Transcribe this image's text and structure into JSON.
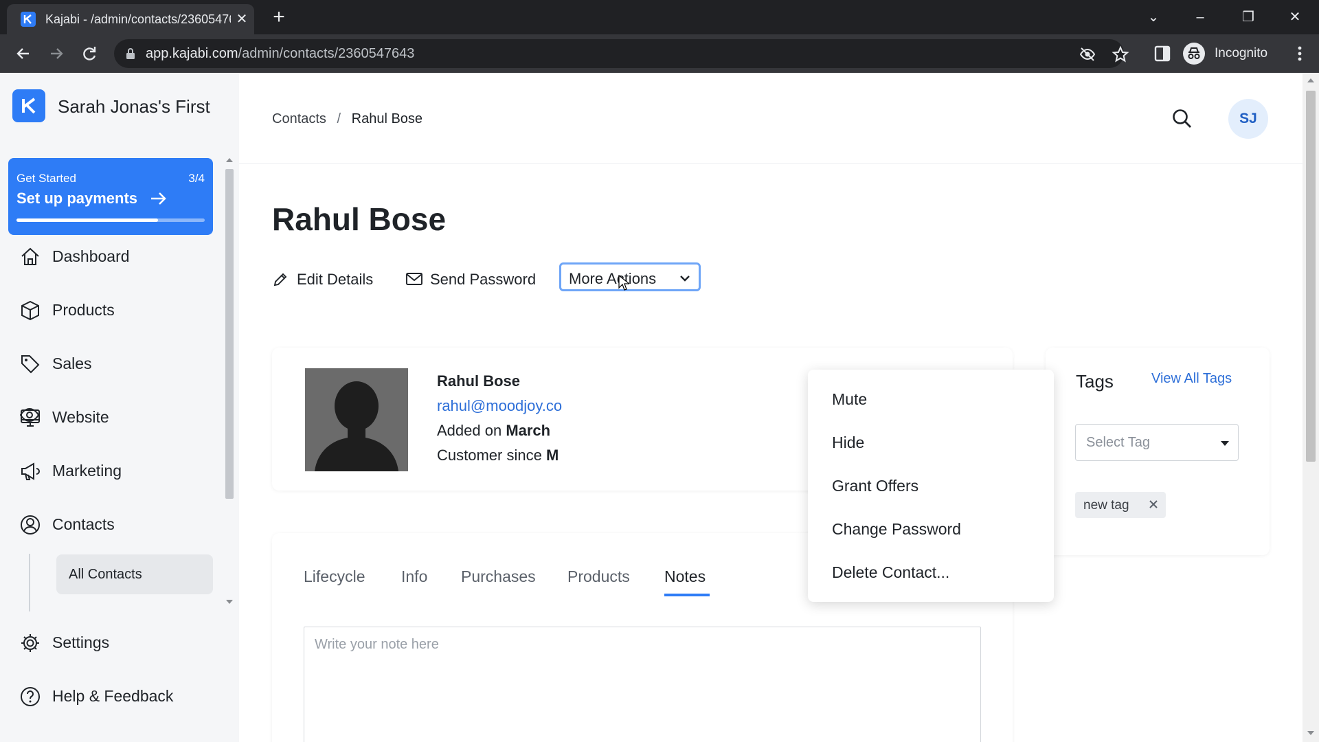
{
  "browser": {
    "tab_title": "Kajabi - /admin/contacts/2360547643",
    "url_host": "app.kajabi.com",
    "url_path": "/admin/contacts/2360547643",
    "profile_label": "Incognito"
  },
  "sidebar": {
    "brand_name": "Sarah Jonas's First",
    "get_started": {
      "label": "Get Started",
      "count": "3/4",
      "title": "Set up payments",
      "progress": 0.75
    },
    "items": [
      {
        "label": "Dashboard",
        "icon": "home-icon"
      },
      {
        "label": "Products",
        "icon": "box-icon"
      },
      {
        "label": "Sales",
        "icon": "tag-icon"
      },
      {
        "label": "Website",
        "icon": "monitor-icon"
      },
      {
        "label": "Marketing",
        "icon": "megaphone-icon"
      },
      {
        "label": "Contacts",
        "icon": "user-circle-icon"
      },
      {
        "label": "Settings",
        "icon": "gear-icon"
      },
      {
        "label": "Help & Feedback",
        "icon": "help-icon"
      }
    ],
    "subitems": [
      {
        "label": "All Contacts",
        "active": true
      }
    ]
  },
  "header": {
    "breadcrumb": [
      "Contacts",
      "Rahul Bose"
    ],
    "breadcrumb_sep": "/",
    "avatar_initials": "SJ"
  },
  "contact": {
    "title": "Rahul Bose",
    "actions": {
      "edit": "Edit Details",
      "send_password": "Send Password",
      "more": "More Actions"
    },
    "name": "Rahul Bose",
    "email": "rahul@moodjoy.co",
    "added_prefix": "Added on ",
    "added_value": "March",
    "customer_prefix": "Customer since ",
    "customer_value": "M"
  },
  "more_actions_menu": [
    "Mute",
    "Hide",
    "Grant Offers",
    "Change Password",
    "Delete Contact..."
  ],
  "tags": {
    "title": "Tags",
    "view_all": "View All Tags",
    "select_placeholder": "Select Tag",
    "chips": [
      "new tag"
    ]
  },
  "tabs": [
    {
      "label": "Lifecycle",
      "active": false
    },
    {
      "label": "Info",
      "active": false
    },
    {
      "label": "Purchases",
      "active": false
    },
    {
      "label": "Products",
      "active": false
    },
    {
      "label": "Notes",
      "active": true
    }
  ],
  "notes": {
    "placeholder": "Write your note here"
  },
  "colors": {
    "accent": "#2e7cf6",
    "link": "#2e6fd8",
    "sidebar_bg": "#f5f6f8"
  }
}
